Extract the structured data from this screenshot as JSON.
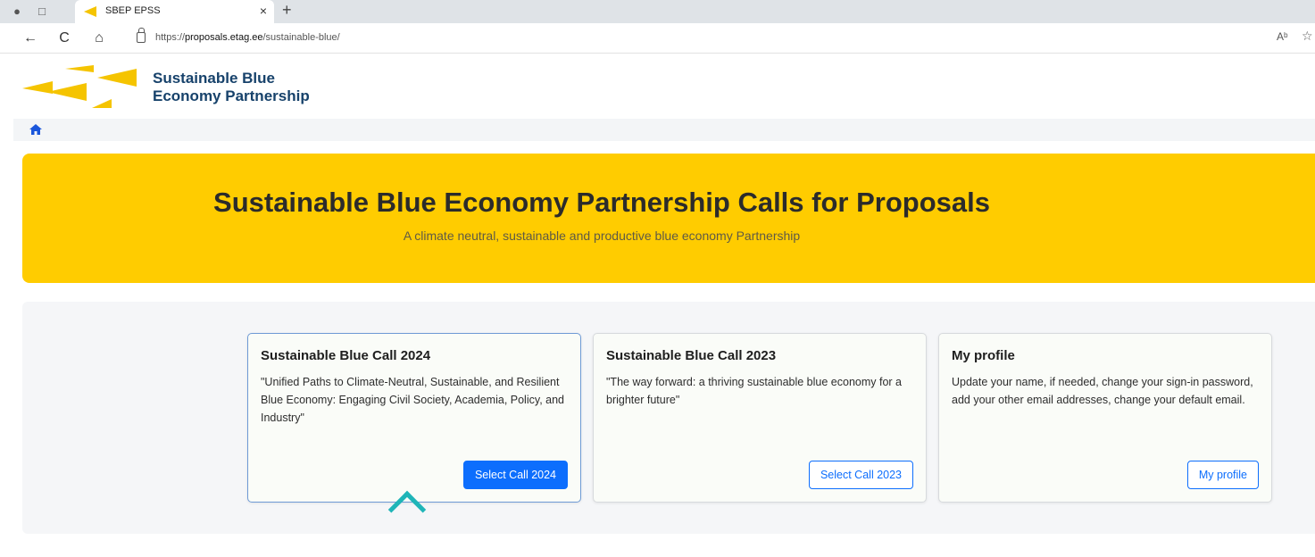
{
  "browser": {
    "tab_title": "SBEP EPSS",
    "tab_close": "×",
    "new_tab": "+",
    "url_prefix": "https://",
    "url_domain": "proposals.etag.ee",
    "url_path": "/sustainable-blue/",
    "read_aloud": "Aᵇ",
    "back": "←",
    "refresh": "C",
    "home": "⌂"
  },
  "site": {
    "brand_line1": "Sustainable Blue",
    "brand_line2": "Economy Partnership",
    "accent": "#ffcc00",
    "brand_color": "#17426b"
  },
  "hero": {
    "title": "Sustainable Blue Economy Partnership Calls for Proposals",
    "subtitle": "A climate neutral, sustainable and productive blue economy Partnership"
  },
  "cards": [
    {
      "title": "Sustainable Blue Call 2024",
      "text": "\"Unified Paths to Climate-Neutral, Sustainable, and Resilient Blue Economy: Engaging Civil Society, Academia, Policy, and Industry\"",
      "button": "Select Call 2024"
    },
    {
      "title": "Sustainable Blue Call 2023",
      "text": "\"The way forward: a thriving sustainable blue economy for a brighter future\"",
      "button": "Select Call 2023"
    },
    {
      "title": "My profile",
      "text": "Update your name, if needed, change your sign-in password, add your other email addresses, change your default email.",
      "button": "My profile"
    }
  ]
}
